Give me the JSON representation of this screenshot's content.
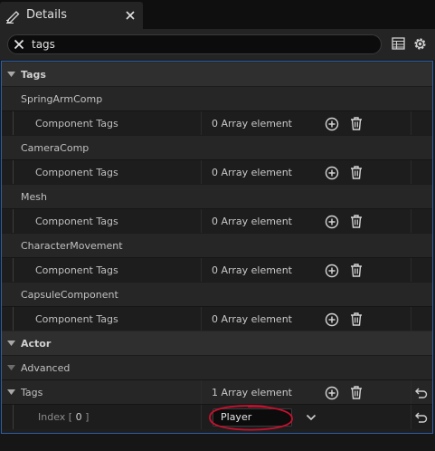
{
  "tab": {
    "title": "Details",
    "close_glyph": "×",
    "icon": "pencil-icon"
  },
  "search": {
    "value": "tags",
    "placeholder": ""
  },
  "toolbar": {
    "icons": [
      "table-view-icon",
      "settings-icon"
    ]
  },
  "groups": [
    {
      "name": "SpringArmComp",
      "property": "Component Tags",
      "value": "0 Array element"
    },
    {
      "name": "CameraComp",
      "property": "Component Tags",
      "value": "0 Array element"
    },
    {
      "name": "Mesh",
      "property": "Component Tags",
      "value": "0 Array element"
    },
    {
      "name": "CharacterMovement",
      "property": "Component Tags",
      "value": "0 Array element"
    },
    {
      "name": "CapsuleComponent",
      "property": "Component Tags",
      "value": "0 Array element"
    }
  ],
  "categories": {
    "tags": "Tags",
    "actor": "Actor"
  },
  "actor": {
    "advanced": "Advanced",
    "tags_label": "Tags",
    "tags_value": "1 Array element",
    "index_label": "Index [ ",
    "index_number": "0",
    "index_suffix": " ]",
    "index_value": "Player"
  },
  "colors": {
    "selection_border": "#2a5ea8",
    "highlight": "#c8102e"
  }
}
